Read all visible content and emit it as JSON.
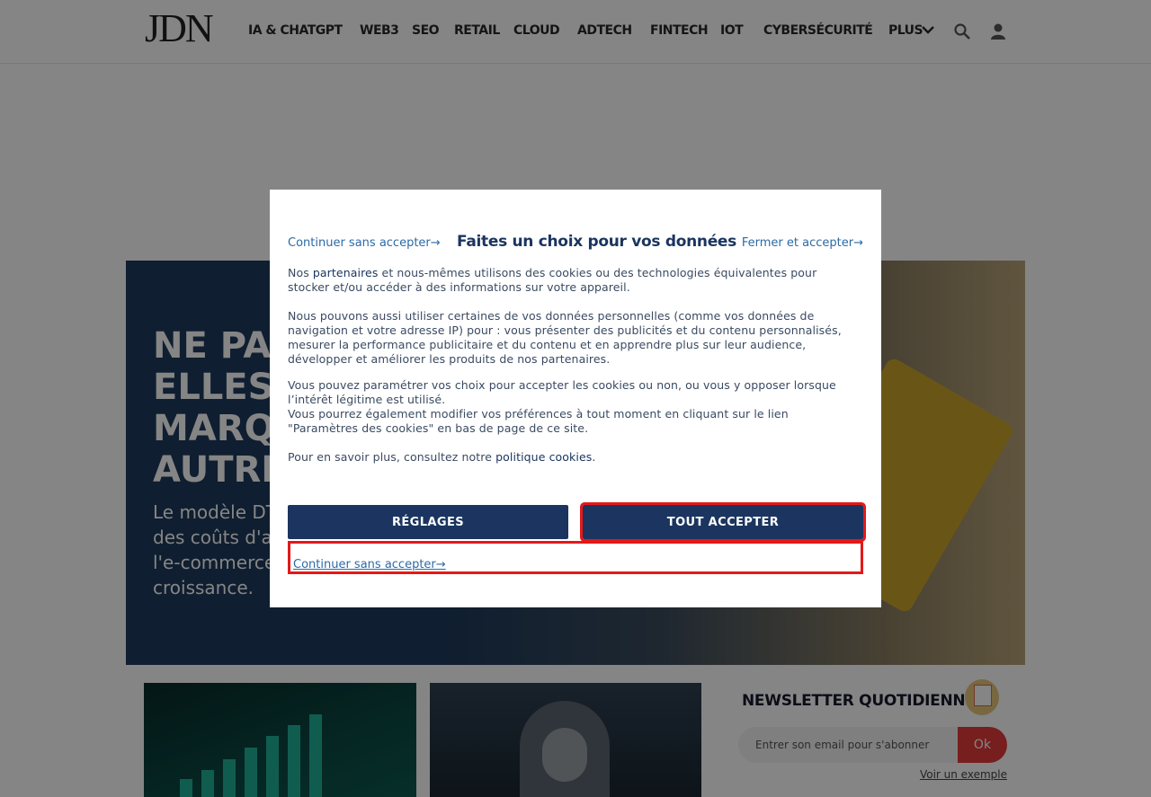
{
  "header": {
    "logo": "JDN",
    "nav": [
      {
        "label": "IA & CHATGPT"
      },
      {
        "label": "WEB3"
      },
      {
        "label": "SEO"
      },
      {
        "label": "RETAIL"
      },
      {
        "label": "CLOUD"
      },
      {
        "label": "ADTECH"
      },
      {
        "label": "FINTECH"
      },
      {
        "label": "IOT"
      },
      {
        "label": "CYBERSÉCURITÉ"
      },
      {
        "label": "PLUS"
      }
    ]
  },
  "hero": {
    "title_visible": "NE PAR\nELLES S\nMARQU\nAUTRE",
    "subtitle_visible": "Le modèle DT\ndes coûts d'ac\nl'e-commerce\ncroissance."
  },
  "newsletter": {
    "title": "NEWSLETTER QUOTIDIENNE",
    "placeholder": "Entrer son email pour s'abonner",
    "submit": "Ok",
    "example_link": "Voir un exemple"
  },
  "consent": {
    "top_left_link": "Continuer sans accepter",
    "title": "Faites un choix pour vos données",
    "top_right_link": "Fermer et accepter",
    "arrow": "→",
    "p1_before": "Nos ",
    "p1_link": "partenaires",
    "p1_after": " et nous-mêmes utilisons des cookies ou des technologies équivalentes pour stocker et/ou accéder à des informations sur votre appareil.",
    "p2": "Nous pouvons aussi utiliser certaines de vos données personnelles (comme vos données de navigation et votre adresse IP) pour : vous présenter des publicités et du contenu personnalisés, mesurer la performance publicitaire et du contenu et en apprendre plus sur leur audience, développer et améliorer les produits de nos partenaires.",
    "p3": "Vous pouvez paramétrer vos choix pour accepter les cookies ou non, ou vous y opposer lorsque l’intérêt légitime est utilisé.",
    "p4": "Vous pourrez également modifier vos préférences à tout moment en cliquant sur le lien \"Paramètres des cookies\" en bas de page de ce site.",
    "p5_before": "Pour en savoir plus, consultez notre ",
    "p5_link": "politique cookies",
    "p5_after": ".",
    "settings_button": "RÉGLAGES",
    "accept_button": "TOUT ACCEPTER",
    "bottom_link": "Continuer sans accepter"
  }
}
